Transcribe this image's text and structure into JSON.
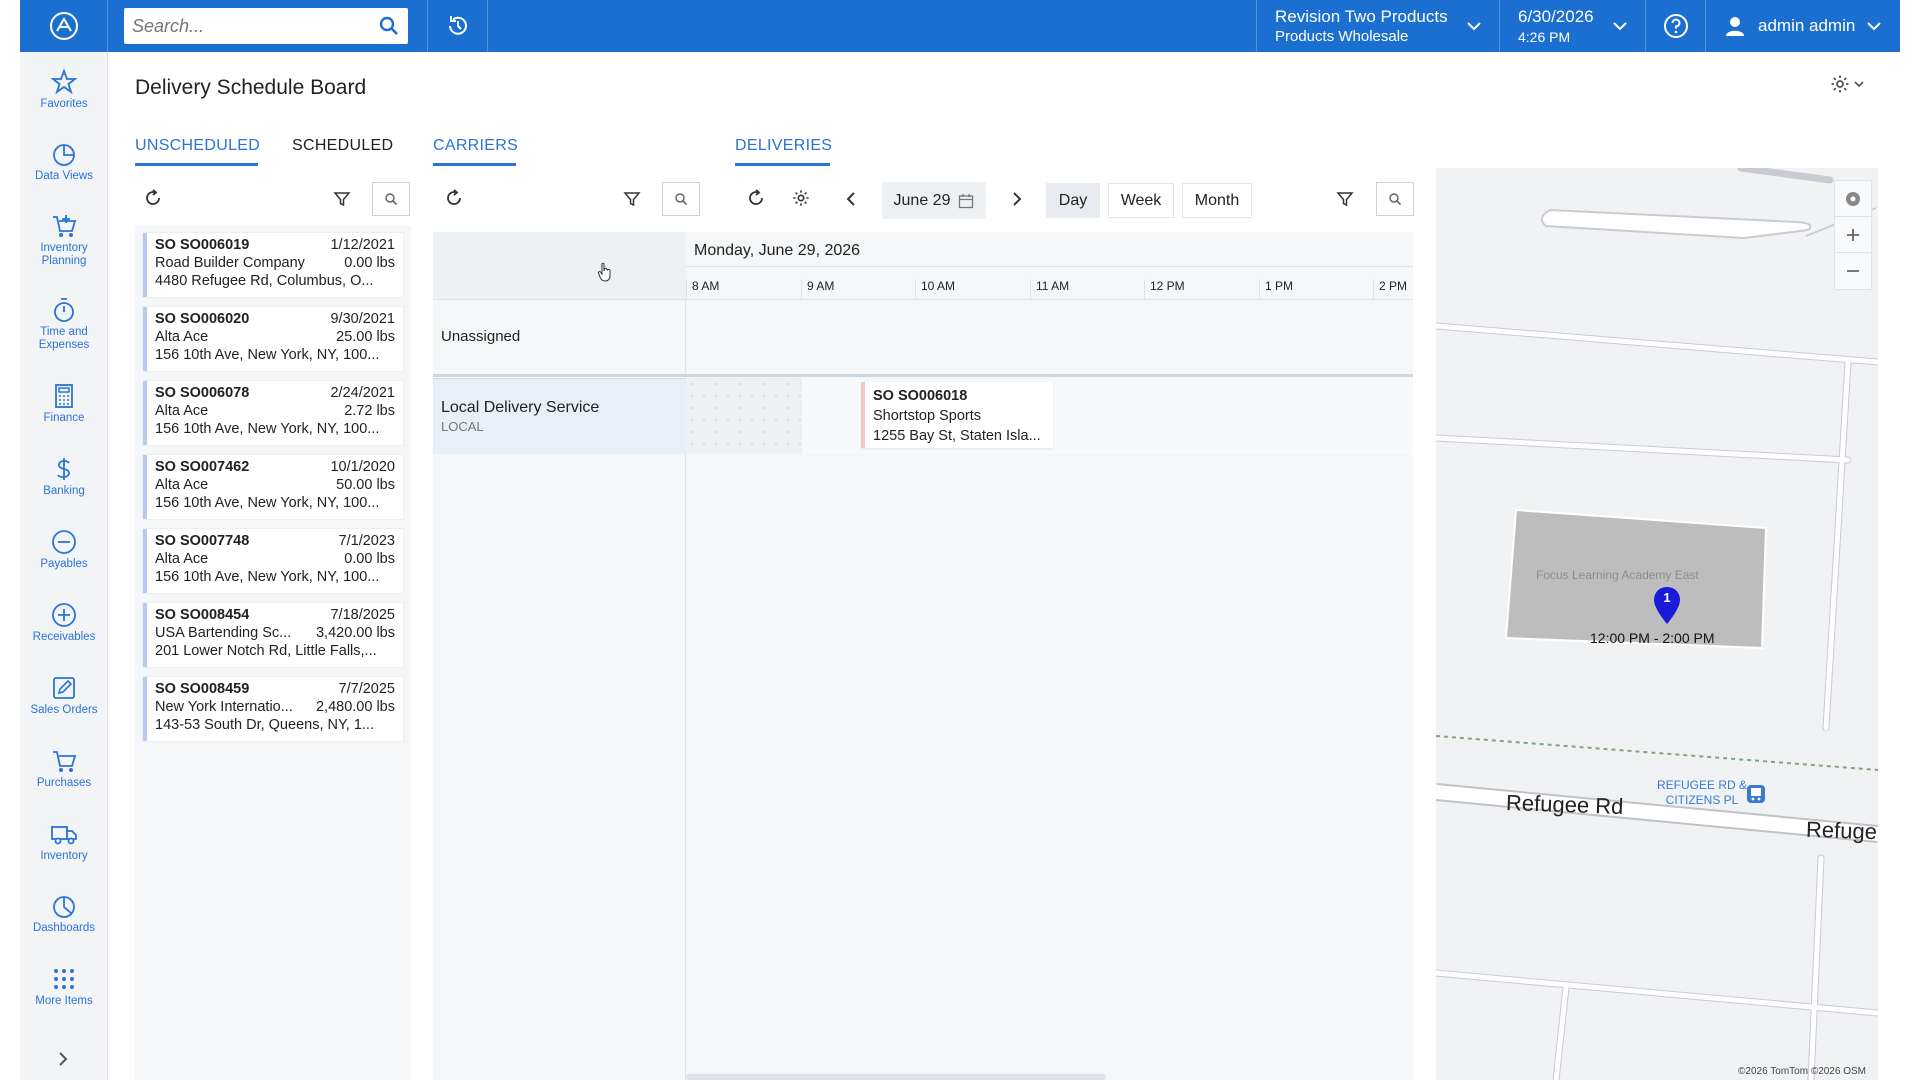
{
  "topbar": {
    "search_placeholder": "Search...",
    "company_name": "Revision Two Products",
    "company_branch": "Products Wholesale",
    "date": "6/30/2026",
    "time": "4:26 PM",
    "user": "admin admin",
    "brand_color": "#1b6fd0"
  },
  "sidebar": {
    "items": [
      {
        "label": "Favorites",
        "icon": "star-icon"
      },
      {
        "label": "Data Views",
        "icon": "pie-chart-icon"
      },
      {
        "label": "Inventory Planning",
        "icon": "cart-plus-icon"
      },
      {
        "label": "Time and Expenses",
        "icon": "stopwatch-icon"
      },
      {
        "label": "Finance",
        "icon": "calculator-icon"
      },
      {
        "label": "Banking",
        "icon": "dollar-icon"
      },
      {
        "label": "Payables",
        "icon": "minus-circle-icon"
      },
      {
        "label": "Receivables",
        "icon": "plus-circle-icon"
      },
      {
        "label": "Sales Orders",
        "icon": "edit-icon"
      },
      {
        "label": "Purchases",
        "icon": "cart-icon"
      },
      {
        "label": "Inventory",
        "icon": "truck-icon"
      },
      {
        "label": "Dashboards",
        "icon": "dashboard-icon"
      },
      {
        "label": "More Items",
        "icon": "grid-icon"
      }
    ]
  },
  "page": {
    "title": "Delivery Schedule Board"
  },
  "tabs": {
    "unscheduled": "UNSCHEDULED",
    "scheduled": "SCHEDULED",
    "carriers": "CARRIERS",
    "deliveries": "DELIVERIES"
  },
  "unscheduled": [
    {
      "so": "SO SO006019",
      "date": "1/12/2021",
      "customer": "Road Builder Company",
      "weight": "0.00 lbs",
      "address": "4480 Refugee Rd, Columbus, O..."
    },
    {
      "so": "SO SO006020",
      "date": "9/30/2021",
      "customer": "Alta Ace",
      "weight": "25.00 lbs",
      "address": "156 10th Ave, New York, NY, 100..."
    },
    {
      "so": "SO SO006078",
      "date": "2/24/2021",
      "customer": "Alta Ace",
      "weight": "2.72 lbs",
      "address": "156 10th Ave, New York, NY, 100..."
    },
    {
      "so": "SO SO007462",
      "date": "10/1/2020",
      "customer": "Alta Ace",
      "weight": "50.00 lbs",
      "address": "156 10th Ave, New York, NY, 100..."
    },
    {
      "so": "SO SO007748",
      "date": "7/1/2023",
      "customer": "Alta Ace",
      "weight": "0.00 lbs",
      "address": "156 10th Ave, New York, NY, 100..."
    },
    {
      "so": "SO SO008454",
      "date": "7/18/2025",
      "customer": "USA Bartending Sc...",
      "weight": "3,420.00 lbs",
      "address": "201 Lower Notch Rd, Little Falls,..."
    },
    {
      "so": "SO SO008459",
      "date": "7/7/2025",
      "customer": "New York Internatio...",
      "weight": "2,480.00 lbs",
      "address": "143-53 South Dr, Queens, NY, 1..."
    }
  ],
  "carriers": {
    "unassigned": "Unassigned",
    "local_name": "Local Delivery Service",
    "local_code": "LOCAL"
  },
  "deliveries": {
    "date_picker": "June 29",
    "views": {
      "day": "Day",
      "week": "Week",
      "month": "Month"
    },
    "active_view": "Day",
    "timeline_date": "Monday, June 29, 2026",
    "hours": [
      "8 AM",
      "9 AM",
      "10 AM",
      "11 AM",
      "12 PM",
      "1 PM",
      "2 PM"
    ],
    "appointment": {
      "so": "SO SO006018",
      "customer": "Shortstop Sports",
      "address": "1255 Bay St, Staten Isla..."
    }
  },
  "map": {
    "poi": "Focus Learning Academy East",
    "pin_number": "1",
    "pin_time": "12:00 PM - 2:00 PM",
    "stop_line1": "REFUGEE RD &",
    "stop_line2": "CITIZENS PL",
    "road_1": "Refugee Rd",
    "road_2": "Refuge",
    "attribution": "©2026 TomTom ©2026 OSM"
  }
}
